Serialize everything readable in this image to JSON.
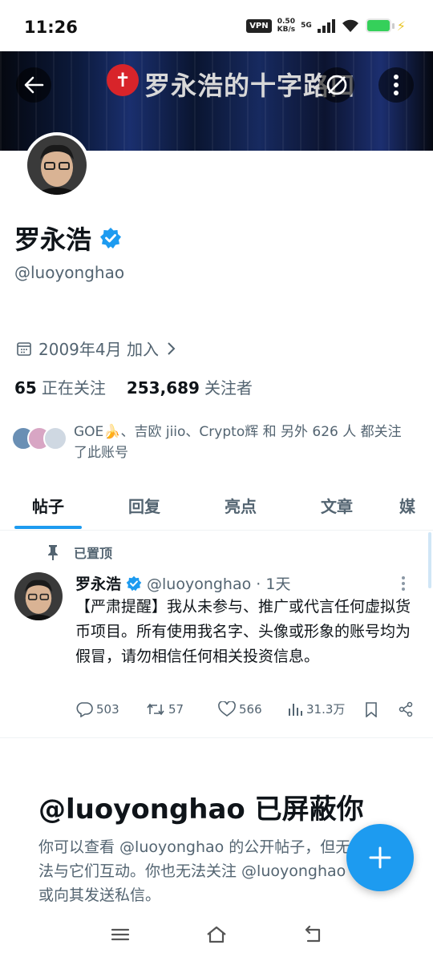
{
  "status_bar": {
    "time": "11:26",
    "vpn": "VPN",
    "speed_value": "0.50",
    "speed_unit": "KB/s",
    "network": "5G"
  },
  "banner": {
    "title": "罗永浩的十字路口",
    "logo_glyph": "✝"
  },
  "profile": {
    "name": "罗永浩",
    "handle": "@luoyonghao",
    "joined": "2009年4月 加入",
    "following_count": "65",
    "following_label": "正在关注",
    "followers_count": "253,689",
    "followers_label": "关注者",
    "followed_by_text": "GOE🍌、吉欧 jiio、Crypto辉 和 另外 626 人 都关注了此账号"
  },
  "tabs": [
    {
      "label": "帖子",
      "active": true
    },
    {
      "label": "回复",
      "active": false
    },
    {
      "label": "亮点",
      "active": false
    },
    {
      "label": "文章",
      "active": false
    },
    {
      "label": "媒",
      "active": false
    }
  ],
  "pinned_post": {
    "pinned_label": "已置顶",
    "author": "罗永浩",
    "meta": "@luoyonghao · 1天",
    "text": "【严肃提醒】我从未参与、推广或代言任何虚拟货币项目。所有使用我名字、头像或形象的账号均为假冒，请勿相信任何相关投资信息。",
    "replies": "503",
    "reposts": "57",
    "likes": "566",
    "views": "31.3万"
  },
  "blocked": {
    "title": "@luoyonghao 已屏蔽你",
    "text": "你可以查看 @luoyonghao 的公开帖子，但无法与它们互动。你也无法关注 @luoyonghao 或向其发送私信。"
  },
  "colors": {
    "accent": "#1d9bf0",
    "text_primary": "#0f1419",
    "text_secondary": "#536471"
  }
}
